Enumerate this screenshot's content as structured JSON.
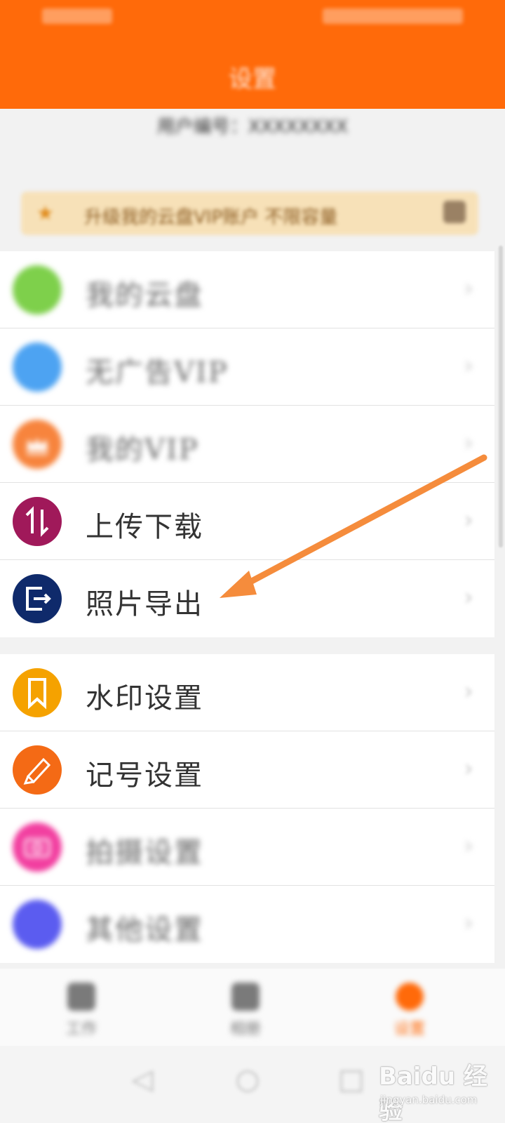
{
  "header": {
    "title": "设置"
  },
  "account": {
    "text": "用户编号：XXXXXXXX"
  },
  "vip_banner": {
    "text": "升级我的云盘VIP账户 不限容量"
  },
  "menu_group_1": [
    {
      "label": "我的云盘",
      "icon": "cloud-drive-icon",
      "color": "#7ed04b"
    },
    {
      "label": "无广告VIP",
      "icon": "no-ads-icon",
      "color": "#4da3f2"
    },
    {
      "label": "我的VIP",
      "icon": "crown-icon",
      "color": "#f7843d"
    },
    {
      "label": "上传下载",
      "icon": "upload-download-icon",
      "color": "#a0195a"
    },
    {
      "label": "照片导出",
      "icon": "export-icon",
      "color": "#0f2a6b"
    }
  ],
  "menu_group_2": [
    {
      "label": "水印设置",
      "icon": "bookmark-icon",
      "color": "#f5a200"
    },
    {
      "label": "记号设置",
      "icon": "marker-icon",
      "color": "#f46a15"
    },
    {
      "label": "拍摄设置",
      "icon": "camera-icon",
      "color": "#f23fa0"
    },
    {
      "label": "其他设置",
      "icon": "other-settings-icon",
      "color": "#5b5cf0"
    }
  ],
  "tabs": [
    {
      "label": "工作",
      "icon": "work-icon"
    },
    {
      "label": "相册",
      "icon": "album-icon"
    },
    {
      "label": "设置",
      "icon": "settings-icon"
    }
  ],
  "chevron": "›",
  "watermark": {
    "main": "Baidu 经验",
    "sub": "jingyan.baidu.com"
  }
}
